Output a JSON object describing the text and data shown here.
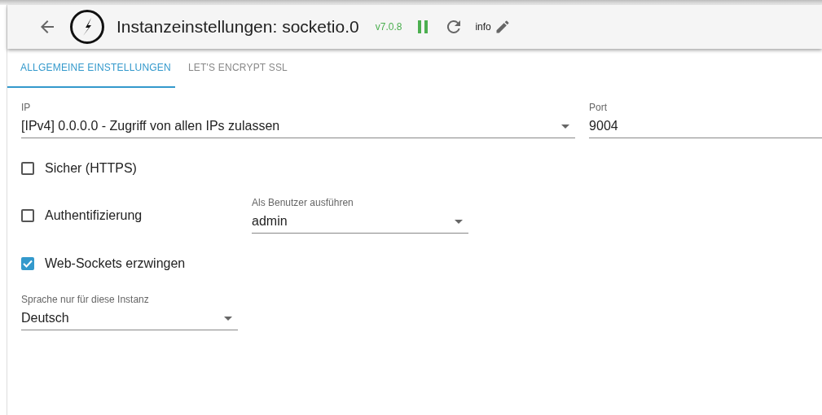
{
  "header": {
    "title": "Instanzeinstellungen: socketio.0",
    "version": "v7.0.8",
    "running": true,
    "info": "info"
  },
  "tabs": [
    {
      "label": "ALLGEMEINE EINSTELLUNGEN",
      "selected": true
    },
    {
      "label": "LET'S ENCRYPT SSL",
      "selected": false
    }
  ],
  "ip": {
    "label": "IP",
    "value": "[IPv4] 0.0.0.0 - Zugriff von allen IPs zulassen"
  },
  "port": {
    "label": "Port",
    "value": "9004"
  },
  "secure": {
    "label": "Sicher (HTTPS)",
    "checked": false
  },
  "auth": {
    "label": "Authentifizierung",
    "checked": false
  },
  "user": {
    "label": "Als Benutzer ausführen",
    "value": "admin"
  },
  "websockets": {
    "label": "Web-Sockets erzwingen",
    "checked": true
  },
  "language": {
    "label": "Sprache nur für diese Instanz",
    "value": "Deutsch"
  }
}
